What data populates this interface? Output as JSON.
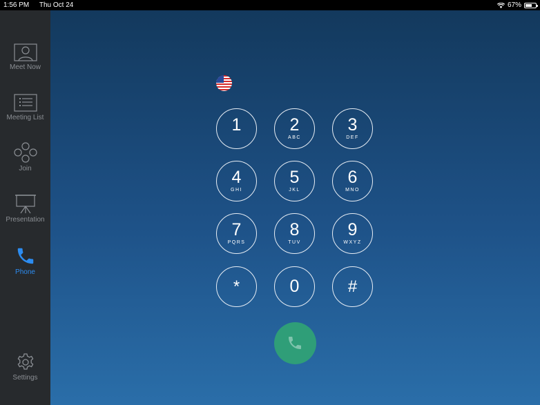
{
  "status_bar": {
    "time": "1:56 PM",
    "date": "Thu Oct 24",
    "battery_percent": "67%",
    "battery_level": 0.67
  },
  "sidebar": {
    "items": [
      {
        "label": "Meet Now",
        "icon": "person-screen-icon"
      },
      {
        "label": "Meeting List",
        "icon": "list-icon"
      },
      {
        "label": "Join",
        "icon": "join-icon"
      },
      {
        "label": "Presentation",
        "icon": "projector-icon"
      },
      {
        "label": "Phone",
        "icon": "phone-icon",
        "active": true
      }
    ],
    "settings": {
      "label": "Settings",
      "icon": "gear-icon"
    }
  },
  "dialer": {
    "country_flag": "us-flag-icon",
    "keys": [
      {
        "digit": "1",
        "letters": ""
      },
      {
        "digit": "2",
        "letters": "ABC"
      },
      {
        "digit": "3",
        "letters": "DEF"
      },
      {
        "digit": "4",
        "letters": "GHI"
      },
      {
        "digit": "5",
        "letters": "JKL"
      },
      {
        "digit": "6",
        "letters": "MNO"
      },
      {
        "digit": "7",
        "letters": "PQRS"
      },
      {
        "digit": "8",
        "letters": "TUV"
      },
      {
        "digit": "9",
        "letters": "WXYZ"
      },
      {
        "digit": "*",
        "letters": ""
      },
      {
        "digit": "0",
        "letters": ""
      },
      {
        "digit": "#",
        "letters": ""
      }
    ],
    "call_button_icon": "phone-icon"
  },
  "colors": {
    "sidebar_bg": "#272a2d",
    "active": "#2c8cf0",
    "call_green": "#2f9e78",
    "bg_top": "#13395d",
    "bg_bottom": "#2a6ea9"
  }
}
